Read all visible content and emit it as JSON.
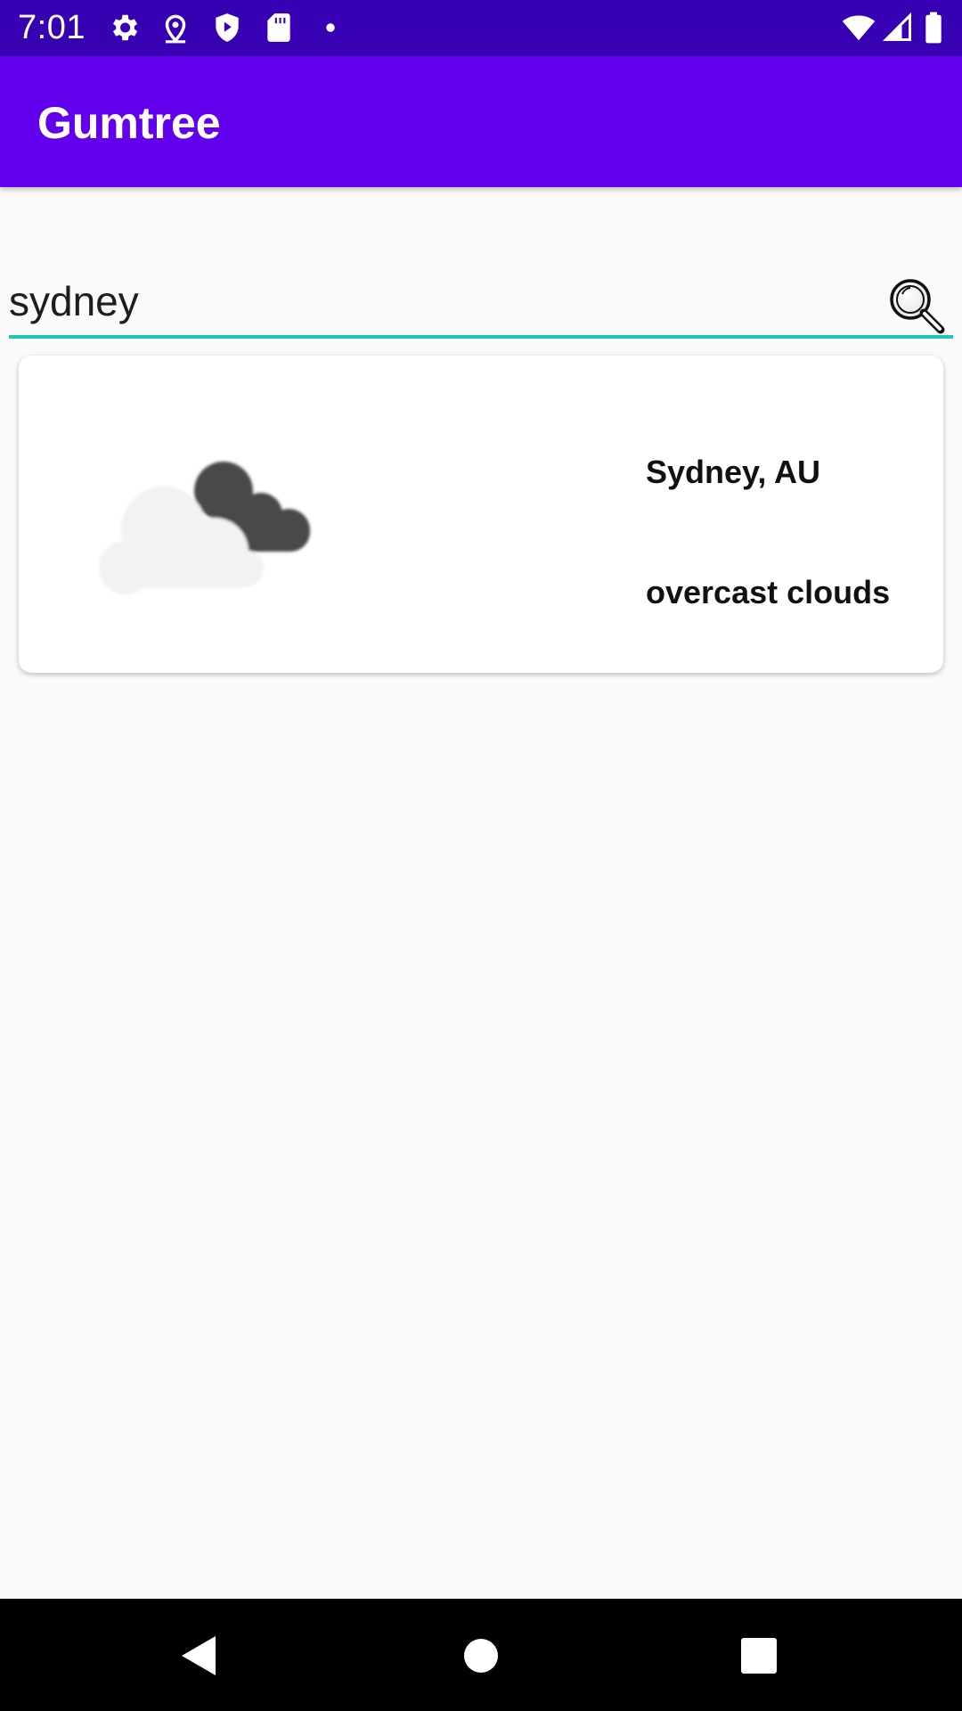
{
  "status_bar": {
    "time": "7:01",
    "left_icons": [
      "settings-icon",
      "location-icon",
      "shield-play-icon",
      "sd-card-icon",
      "notification-dot-icon"
    ],
    "right_icons": [
      "wifi-icon",
      "cellular-signal-icon",
      "battery-icon"
    ]
  },
  "app_bar": {
    "title": "Gumtree"
  },
  "search": {
    "value": "sydney",
    "button_icon": "search-icon"
  },
  "weather_card": {
    "icon": "overcast-clouds-icon",
    "city": "Sydney, AU",
    "description": "overcast clouds"
  },
  "nav_bar": {
    "buttons": [
      "back-icon",
      "home-icon",
      "recents-icon"
    ]
  },
  "colors": {
    "status_bar": "#3700B3",
    "app_bar": "#6200EE",
    "accent": "#1DC7B3",
    "background": "#FAFAFA"
  }
}
